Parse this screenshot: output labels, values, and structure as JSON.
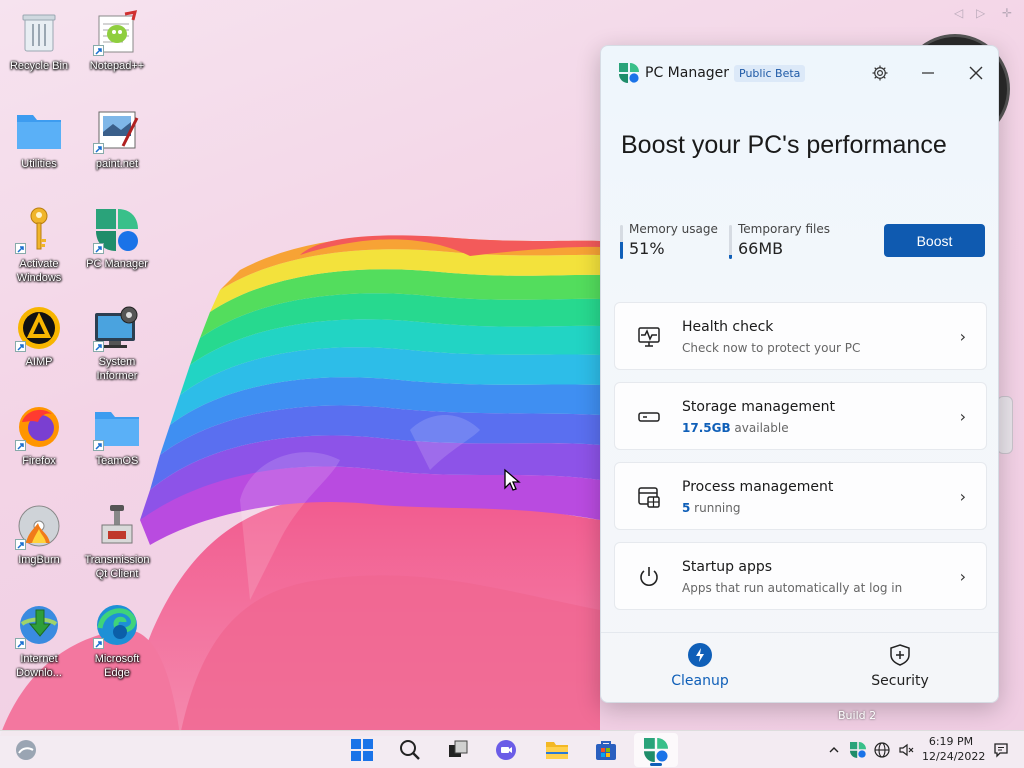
{
  "desktop": {
    "icons": [
      {
        "label": "Recycle Bin"
      },
      {
        "label": "Notepad++"
      },
      {
        "label": "Utilities"
      },
      {
        "label": "paint.net"
      },
      {
        "label": "Activate\nWindows"
      },
      {
        "label": "PC Manager"
      },
      {
        "label": "AIMP"
      },
      {
        "label": "System\nInformer"
      },
      {
        "label": "Firefox"
      },
      {
        "label": "TeamOS"
      },
      {
        "label": "ImgBurn"
      },
      {
        "label": "Transmission\nQt Client"
      },
      {
        "label": "Internet\nDownlo..."
      },
      {
        "label": "Microsoft\nEdge"
      }
    ],
    "build_text": "Build 2"
  },
  "pc_manager": {
    "title": "PC Manager",
    "badge": "Public Beta",
    "hero_title": "Boost your PC's performance",
    "memory": {
      "label": "Memory usage",
      "value": "51%",
      "fill": 0.51
    },
    "temp": {
      "label": "Temporary files",
      "value": "66MB",
      "fill": 0.12
    },
    "boost_label": "Boost",
    "cards": [
      {
        "title": "Health check",
        "sub": "Check now to protect your PC",
        "icon": "health-check-icon"
      },
      {
        "title": "Storage management",
        "sub_strong": "17.5GB",
        "sub_rest": " available",
        "icon": "storage-icon"
      },
      {
        "title": "Process management",
        "sub_strong": "5",
        "sub_rest": " running",
        "icon": "process-icon"
      },
      {
        "title": "Startup apps",
        "sub": "Apps that run automatically at log in",
        "icon": "power-icon"
      }
    ],
    "nav": [
      {
        "label": "Cleanup",
        "active": true
      },
      {
        "label": "Security",
        "active": false
      }
    ],
    "accent": "#0f5fb8"
  },
  "taskbar": {
    "clock_time": "6:19 PM",
    "clock_date": "12/24/2022"
  }
}
